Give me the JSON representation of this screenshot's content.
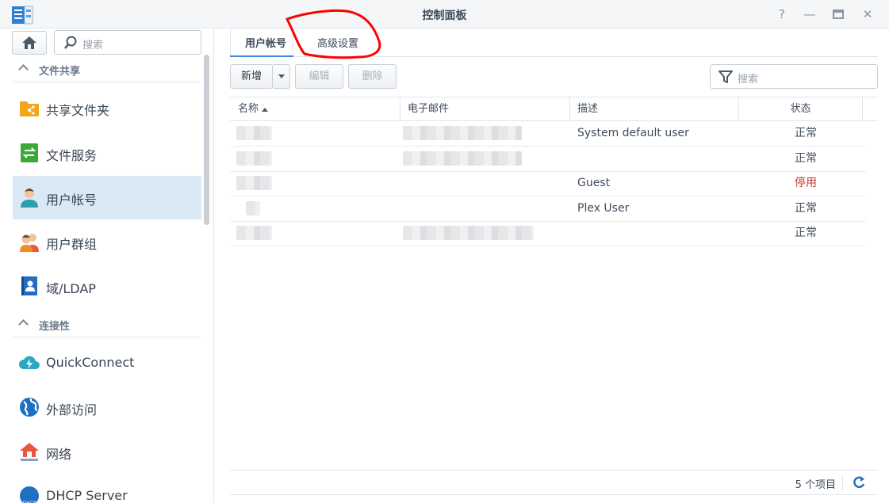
{
  "window": {
    "title": "控制面板",
    "controls": [
      "help-icon",
      "minimize-icon",
      "maximize-icon",
      "close-icon"
    ]
  },
  "sidebar": {
    "search_placeholder": "搜索",
    "sections": [
      {
        "label": "文件共享"
      },
      {
        "label": "连接性"
      }
    ],
    "items": [
      {
        "label": "共享文件夹",
        "icon": "shared-folder-icon"
      },
      {
        "label": "文件服务",
        "icon": "file-services-icon"
      },
      {
        "label": "用户帐号",
        "icon": "user-icon",
        "active": true
      },
      {
        "label": "用户群组",
        "icon": "group-icon"
      },
      {
        "label": "域/LDAP",
        "icon": "domain-ldap-icon"
      },
      {
        "label": "QuickConnect",
        "icon": "quickconnect-icon"
      },
      {
        "label": "外部访问",
        "icon": "external-access-icon"
      },
      {
        "label": "网络",
        "icon": "network-icon"
      },
      {
        "label": "DHCP Server",
        "icon": "dhcp-icon"
      }
    ]
  },
  "tabs": [
    {
      "label": "用户帐号",
      "active": true
    },
    {
      "label": "高级设置"
    }
  ],
  "toolbar": {
    "add": "新增",
    "edit": "编辑",
    "delete": "删除",
    "search_placeholder": "搜索"
  },
  "table": {
    "columns": [
      "名称",
      "电子邮件",
      "描述",
      "状态"
    ],
    "rows": [
      {
        "description": "System default user",
        "status": "正常"
      },
      {
        "description": "",
        "status": "正常"
      },
      {
        "description": "Guest",
        "status": "停用"
      },
      {
        "description": "Plex User",
        "status": "正常"
      },
      {
        "description": "",
        "status": "正常"
      }
    ],
    "footer_count": "5 个项目"
  },
  "colors": {
    "accent": "#3f88d6",
    "active_bg": "#dbe8f6",
    "disabled_status": "#c0392b",
    "annotation": "#ff0000"
  }
}
